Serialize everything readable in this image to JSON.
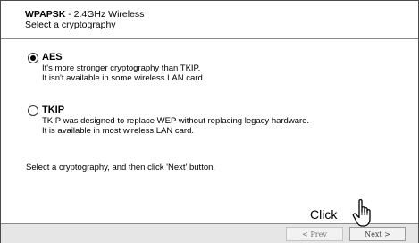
{
  "header": {
    "title_bold": "WPAPSK",
    "title_rest": " - 2.4GHz Wireless",
    "subtitle": "Select a cryptography"
  },
  "options": [
    {
      "label": "AES",
      "selected": true,
      "desc_line1": "It's more stronger cryptography than TKIP.",
      "desc_line2": "It isn't available in some wireless LAN card."
    },
    {
      "label": "TKIP",
      "selected": false,
      "desc_line1": "TKIP was designed to replace WEP without replacing legacy hardware.",
      "desc_line2": "It is available in most wireless LAN card."
    }
  ],
  "instruction": "Select a cryptography, and then click 'Next' button.",
  "annotation": {
    "click_label": "Click",
    "pointer_icon": "hand-pointer-icon"
  },
  "footer": {
    "prev_label": "< Prev",
    "next_label": "Next >"
  }
}
